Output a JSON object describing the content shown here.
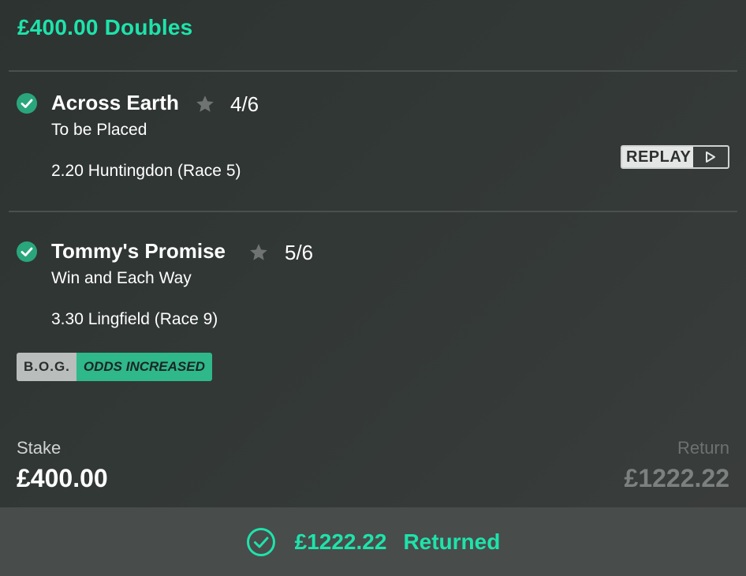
{
  "bet": {
    "title": "£400.00 Doubles"
  },
  "selections": [
    {
      "runner": "Across Earth",
      "odds": "4/6",
      "market": "To be Placed",
      "race": "2.20 Huntingdon (Race 5)",
      "status_icon": "check-circle-icon",
      "favourite_icon": "star-icon"
    },
    {
      "runner": "Tommy's Promise",
      "odds": "5/6",
      "market": "Win and Each Way",
      "race": "3.30 Lingfield (Race 9)",
      "status_icon": "check-circle-icon",
      "favourite_icon": "star-icon"
    }
  ],
  "replay": {
    "label": "REPLAY",
    "icon": "play-icon"
  },
  "badge": {
    "bog": "B.O.G.",
    "odds_increased": "ODDS INCREASED"
  },
  "totals": {
    "stake_label": "Stake",
    "stake_value": "£400.00",
    "return_label": "Return",
    "return_value": "£1222.22"
  },
  "footer": {
    "amount": "£1222.22",
    "status": "Returned",
    "icon": "check-circle-outline-icon"
  },
  "colors": {
    "accent": "#1ee3ab",
    "badge_green": "#2fb88a",
    "check_green": "#2aa67c",
    "star_grey": "#6f7473"
  }
}
